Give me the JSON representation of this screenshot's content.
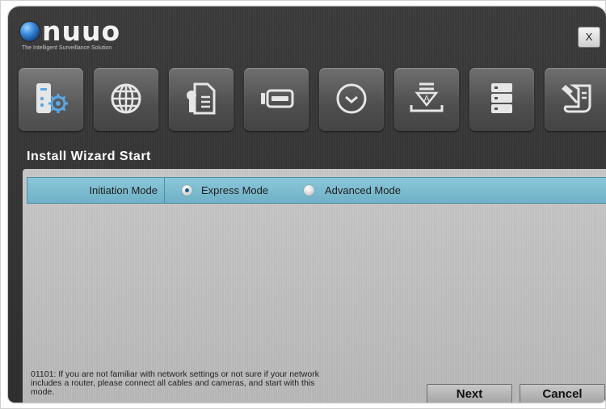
{
  "app": {
    "logo_text": "nuuo",
    "tagline": "The Intelligent Surveillance Solution",
    "close_label": "X"
  },
  "toolbar": {
    "items": [
      {
        "name": "system-settings",
        "icon": "server-gear-icon",
        "active": true
      },
      {
        "name": "network",
        "icon": "globe-icon",
        "active": false
      },
      {
        "name": "license",
        "icon": "certificate-icon",
        "active": false
      },
      {
        "name": "storage-drive",
        "icon": "hard-drive-icon",
        "active": false
      },
      {
        "name": "schedule",
        "icon": "clock-icon",
        "active": false
      },
      {
        "name": "install",
        "icon": "install-tray-icon",
        "active": false
      },
      {
        "name": "server-list",
        "icon": "server-rack-icon",
        "active": false
      },
      {
        "name": "tools",
        "icon": "tools-document-icon",
        "active": false
      }
    ]
  },
  "wizard": {
    "title": "Install Wizard Start",
    "initiation_label": "Initiation Mode",
    "options": {
      "express": {
        "label": "Express Mode",
        "checked": true
      },
      "advanced": {
        "label": "Advanced Mode",
        "checked": false
      }
    },
    "hint": "01101: If you are not familiar with network settings or not sure if your network includes a router, please connect all cables and cameras, and start with this mode.",
    "next_label": "Next",
    "cancel_label": "Cancel"
  },
  "colors": {
    "window_bg": "#2f2f2f",
    "panel_bg": "#bdbdbd",
    "highlight_row": "#7cbccf",
    "icon_tint": "#e6e6e6",
    "icon_accent": "#5aa7e6"
  }
}
